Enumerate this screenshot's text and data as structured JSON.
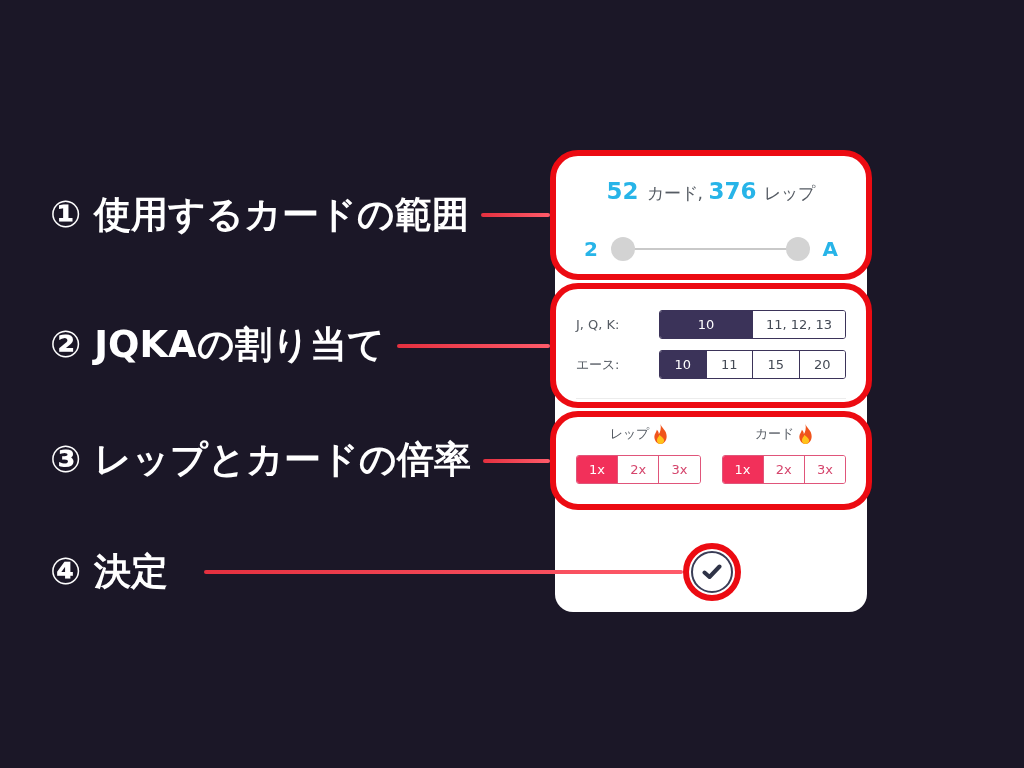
{
  "sections": [
    {
      "kind": "range",
      "annotation": "① 使用するカードの範囲",
      "summary": [
        {
          "text": "52",
          "kind": "number"
        },
        {
          "text": "カード,",
          "kind": "unit"
        },
        {
          "text": "376",
          "kind": "number"
        },
        {
          "text": "レップ",
          "kind": "unit"
        }
      ],
      "slider": {
        "min_label": "2",
        "max_label": "A",
        "thumbs": [
          {
            "level": 0
          },
          {
            "level": 1
          }
        ]
      }
    },
    {
      "kind": "values",
      "annotation": "② JQKAの割り当て",
      "rows": [
        {
          "label": "J, Q, K:",
          "options": [
            {
              "label": "10",
              "selected": true
            },
            {
              "label": "11, 12, 13",
              "selected": false
            }
          ]
        },
        {
          "label": "エース:",
          "options": [
            {
              "label": "10",
              "selected": true
            },
            {
              "label": "11",
              "selected": false
            },
            {
              "label": "15",
              "selected": false
            },
            {
              "label": "20",
              "selected": false
            }
          ]
        }
      ]
    },
    {
      "kind": "multipliers",
      "annotation": "③ レップとカードの倍率",
      "groups": [
        {
          "label": "レップ",
          "options": [
            {
              "label": "1x",
              "selected": true
            },
            {
              "label": "2x",
              "selected": false
            },
            {
              "label": "3x",
              "selected": false
            }
          ]
        },
        {
          "label": "カード",
          "options": [
            {
              "label": "1x",
              "selected": true
            },
            {
              "label": "2x",
              "selected": false
            },
            {
              "label": "3x",
              "selected": false
            }
          ]
        }
      ]
    },
    {
      "kind": "confirm",
      "annotation": "④ 決定"
    }
  ]
}
